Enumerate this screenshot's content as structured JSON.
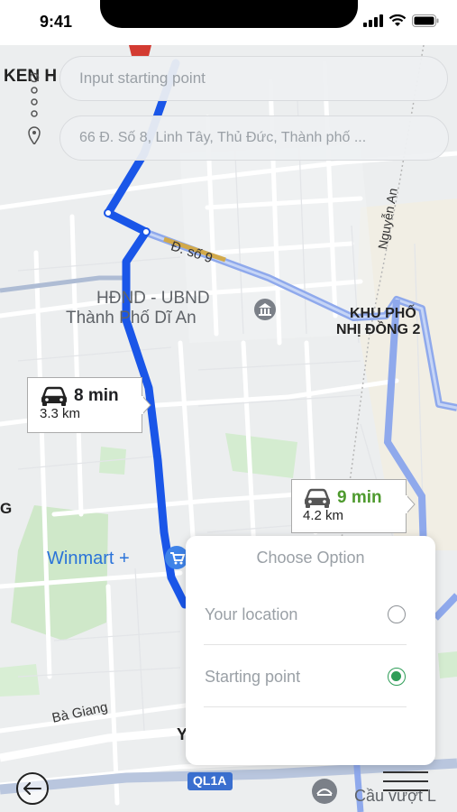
{
  "status_bar": {
    "time": "9:41"
  },
  "search": {
    "start_placeholder": "Input starting point",
    "destination_value": "66 Đ. Số 8, Linh Tây, Thủ Đức, Thành phố ..."
  },
  "map": {
    "labels": {
      "top_left": "KEN H",
      "street_so9": "Đ. số 9",
      "street_nguyen_an": "Nguyễn An",
      "poi_line1": "HĐND - UBND",
      "poi_line2": "Thành Phố Dĩ An",
      "area_line1": "KHU PHỐ",
      "area_line2": "NHỊ ĐỒNG 2",
      "winmart": "Winmart +",
      "ba_giang": "Bà Giang",
      "ql1a": "QL1A",
      "cau_vuot": "Cầu vượt L",
      "edge_g": "G",
      "edge_y": "Y"
    },
    "routes": [
      {
        "time": "8 min",
        "distance": "3.3 km",
        "time_color": "#202124"
      },
      {
        "time": "9 min",
        "distance": "4.2 km",
        "time_color": "#4e9a2e"
      }
    ]
  },
  "options": {
    "title": "Choose Option",
    "items": [
      {
        "label": "Your location",
        "selected": false
      },
      {
        "label": "Starting point",
        "selected": true
      }
    ]
  },
  "icons": {
    "back": "arrow-left-icon",
    "menu": "menu-icon",
    "car": "car-icon",
    "cart": "shopping-cart-icon",
    "poi": "government-building-icon"
  },
  "colors": {
    "route_primary": "#1a56e8",
    "route_alt": "#8fa9ec",
    "accent_green": "#2e9d57"
  }
}
